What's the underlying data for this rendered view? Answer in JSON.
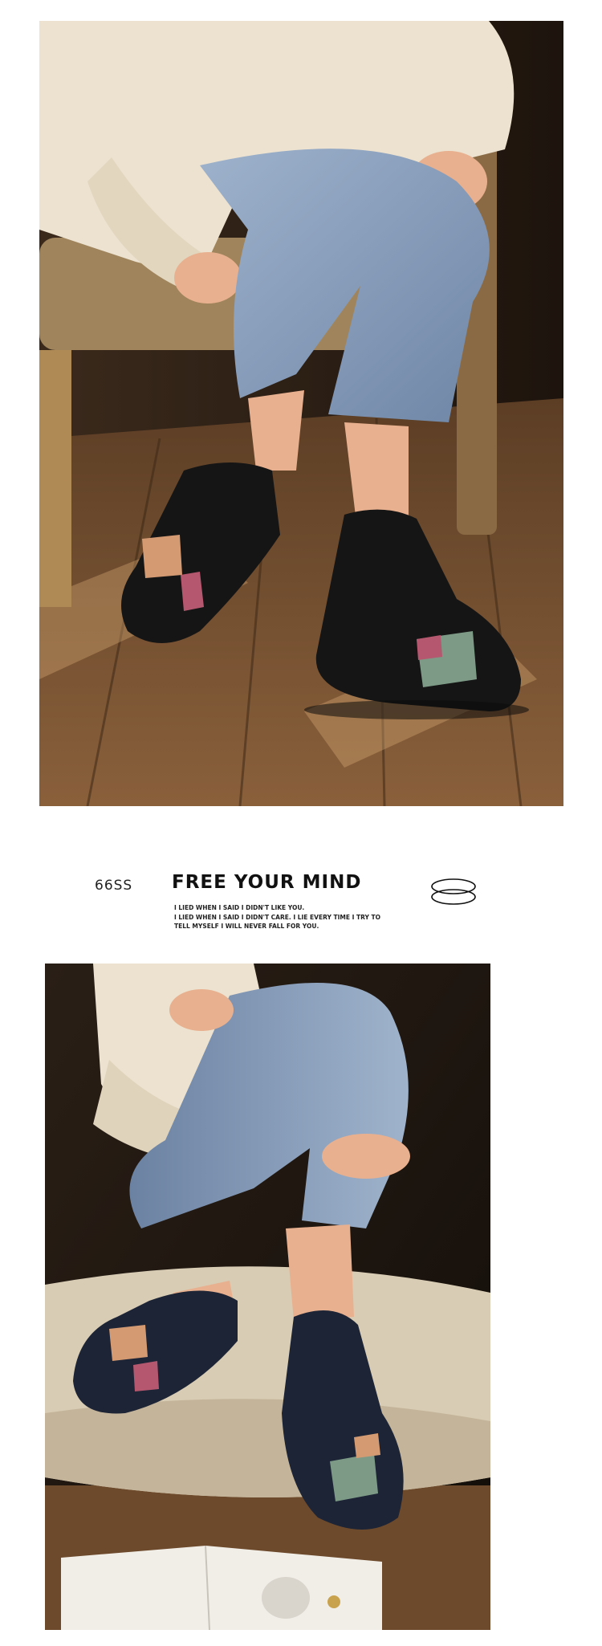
{
  "banner": {
    "brand_code": "66SS",
    "headline": "FREE YOUR MIND",
    "lines": [
      "I LIED WHEN I SAID I DIDN'T LIKE YOU.",
      "I LIED WHEN I SAID I DIDN'T CARE. I LIE EVERY TIME I TRY TO",
      "TELL MYSELF I WILL NEVER FALL FOR YOU."
    ],
    "icon": "double-ellipse-icon"
  },
  "photos": [
    {
      "icon": "product-photo-black-boots-on-wooden-floor"
    },
    {
      "icon": "product-photo-navy-boots-on-cushion"
    }
  ],
  "colors": {
    "floor_wood": "#7a5232",
    "denim": "#8aa0bd",
    "blouse": "#ece2cf",
    "boot_black": "#151515",
    "boot_navy": "#1c2436",
    "patch_tan": "#d49a72",
    "patch_plaid": "#b5576e",
    "patch_green": "#7c9a86"
  }
}
